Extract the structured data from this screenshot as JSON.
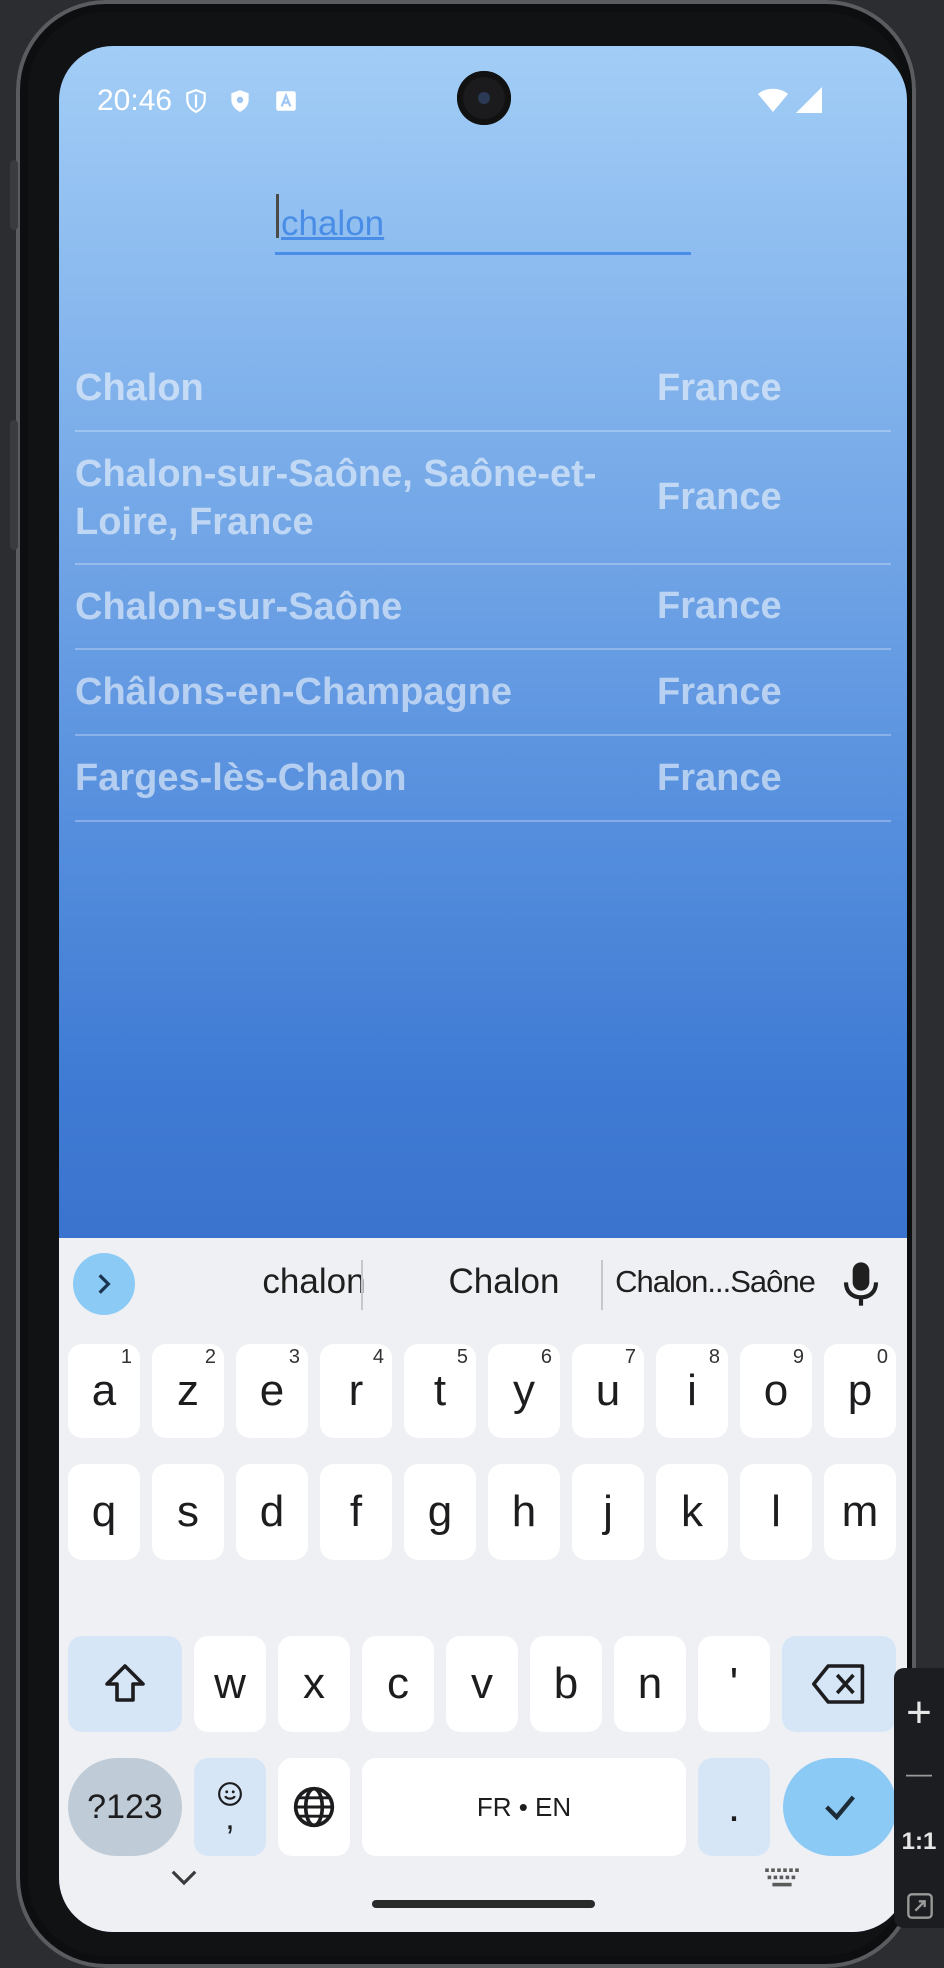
{
  "status_bar": {
    "time": "20:46"
  },
  "search": {
    "value": "chalon"
  },
  "results": [
    {
      "city": "Chalon",
      "country": "France"
    },
    {
      "city": "Chalon-sur-Saône, Saône-et-Loire, France",
      "country": "France"
    },
    {
      "city": "Chalon-sur-Saône",
      "country": "France"
    },
    {
      "city": "Châlons-en-Champagne",
      "country": "France"
    },
    {
      "city": "Farges-lès-Chalon",
      "country": "France"
    }
  ],
  "keyboard": {
    "suggestions": [
      "chalon",
      "Chalon",
      "Chalon...Saône"
    ],
    "row1": [
      {
        "k": "a",
        "h": "1"
      },
      {
        "k": "z",
        "h": "2"
      },
      {
        "k": "e",
        "h": "3"
      },
      {
        "k": "r",
        "h": "4"
      },
      {
        "k": "t",
        "h": "5"
      },
      {
        "k": "y",
        "h": "6"
      },
      {
        "k": "u",
        "h": "7"
      },
      {
        "k": "i",
        "h": "8"
      },
      {
        "k": "o",
        "h": "9"
      },
      {
        "k": "p",
        "h": "0"
      }
    ],
    "row2": [
      "q",
      "s",
      "d",
      "f",
      "g",
      "h",
      "j",
      "k",
      "l",
      "m"
    ],
    "row3": [
      "w",
      "x",
      "c",
      "v",
      "b",
      "n",
      "'"
    ],
    "symbols_label": "?123",
    "comma_label": ",",
    "space_label": "FR • EN",
    "period_label": "."
  },
  "emulator_toolbar": {
    "plus": "+",
    "minus": "—",
    "ratio": "1:1"
  },
  "colors": {
    "accent": "#4a8de6",
    "enter_key": "#8ccaf6",
    "modifier_key": "#d6e6f7"
  }
}
